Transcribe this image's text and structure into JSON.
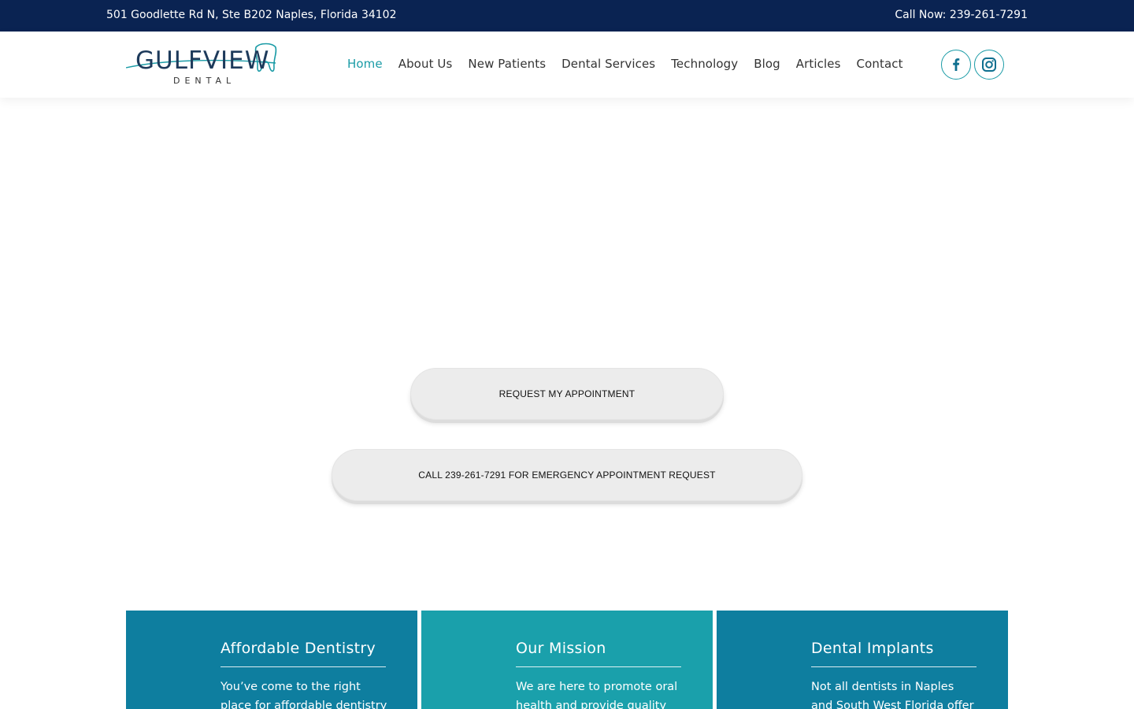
{
  "topbar": {
    "address": "501 Goodlette Rd N, Ste B202 Naples, Florida 34102",
    "phone": "Call Now: 239-261-7291"
  },
  "logo": {
    "word": "GULFVIEW",
    "sub": "DENTAL"
  },
  "nav": {
    "items": [
      {
        "label": "Home",
        "active": true
      },
      {
        "label": "About Us"
      },
      {
        "label": "New Patients"
      },
      {
        "label": "Dental Services"
      },
      {
        "label": "Technology"
      },
      {
        "label": "Blog"
      },
      {
        "label": "Articles"
      },
      {
        "label": "Contact"
      }
    ]
  },
  "social": {
    "icons": [
      "facebook-icon",
      "instagram-icon"
    ],
    "accent": "#1a9ba6"
  },
  "buttons": {
    "request": "REQUEST MY APPOINTMENT",
    "emergency": "CALL 239-261-7291 FOR EMERGENCY APPOINTMENT REQUEST"
  },
  "cards": [
    {
      "title": "Affordable Dentistry",
      "text": "You’ve come to the right place for affordable dentistry",
      "color": "#0e7e9f"
    },
    {
      "title": "Our Mission",
      "text": "We are here to promote oral health and provide quality",
      "color": "#1aa0ab"
    },
    {
      "title": "Dental Implants",
      "text": "Not all dentists in Naples and South West Florida offer",
      "color": "#0e7e9f"
    }
  ],
  "colors": {
    "topbar": "#0a2352",
    "accent": "#1a9ba6"
  }
}
